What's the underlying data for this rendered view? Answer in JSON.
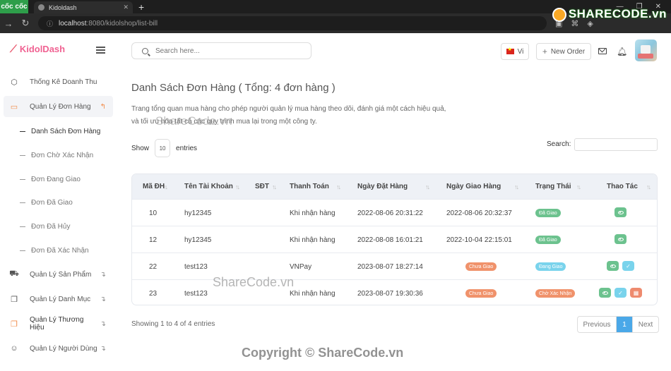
{
  "browser": {
    "brand_label": "cốc cốc",
    "tab_title": "Kidoldash",
    "url_host": "localhost",
    "url_path": ":8080/kidolshop/list-bill",
    "watermark_logo": "SHARECODE.vn"
  },
  "sidebar": {
    "logo_text": "KidolDash",
    "items": [
      {
        "label": "Thống Kê Doanh Thu",
        "icon": "cube-icon",
        "arrow": ""
      },
      {
        "label": "Quản Lý Đơn Hàng",
        "icon": "card-icon",
        "arrow": "↰"
      },
      {
        "label": "Quản Lý Sản Phẩm",
        "icon": "cart-icon",
        "arrow": "↴"
      },
      {
        "label": "Quản Lý Danh Mục",
        "icon": "copy-icon",
        "arrow": "↴"
      },
      {
        "label": "Quản Lý Thương Hiệu",
        "icon": "layers-icon",
        "arrow": "↴"
      },
      {
        "label": "Quản Lý Người Dùng",
        "icon": "users-icon",
        "arrow": "↴"
      }
    ],
    "sub_items": [
      "Danh Sách Đơn Hàng",
      "Đơn Chờ Xác Nhận",
      "Đơn Đang Giao",
      "Đơn Đã Giao",
      "Đơn Đã Hủy",
      "Đơn Đã Xác Nhận"
    ]
  },
  "header": {
    "search_placeholder": "Search here...",
    "lang_label": "Vi",
    "new_order_label": "New Order"
  },
  "main": {
    "title": "Danh Sách Đơn Hàng ( Tổng: 4 đơn hàng )",
    "desc_line1": "Trang tổng quan mua hàng cho phép người quản lý mua hàng theo dõi, đánh giá một cách hiệu quả,",
    "desc_line2": "và tối ưu hóa tất cả các quy trình mua lại trong một công ty.",
    "show_label": "Show",
    "entries_value": "10",
    "entries_label": "entries",
    "search_label": "Search:",
    "table": {
      "headers": [
        "Mã ĐH",
        "Tên Tài Khoản",
        "SĐT",
        "Thanh Toán",
        "Ngày Đặt Hàng",
        "Ngày Giao Hàng",
        "Trạng Thái",
        "Thao Tác"
      ],
      "rows": [
        {
          "id": "10",
          "account": "hy12345",
          "phone": "",
          "payment": "Khi nhận hàng",
          "order_date": "2022-08-06 20:31:22",
          "delivery": "2022-08-06 20:32:37",
          "delivery_badge": "",
          "status": "Đã Giao"
        },
        {
          "id": "12",
          "account": "hy12345",
          "phone": "",
          "payment": "Khi nhận hàng",
          "order_date": "2022-08-08 16:01:21",
          "delivery": "2022-10-04 22:15:01",
          "delivery_badge": "",
          "status": "Đã Giao"
        },
        {
          "id": "22",
          "account": "test123",
          "phone": "",
          "payment": "VNPay",
          "order_date": "2023-08-07 18:27:14",
          "delivery": "",
          "delivery_badge": "Chưa Giao",
          "status": "Đang Giao"
        },
        {
          "id": "23",
          "account": "test123",
          "phone": "",
          "payment": "Khi nhận hàng",
          "order_date": "2023-08-07 19:30:36",
          "delivery": "",
          "delivery_badge": "Chưa Giao",
          "status": "Chờ Xác Nhận"
        }
      ]
    },
    "showing_text": "Showing 1 to 4 of 4 entries",
    "pager": {
      "prev": "Previous",
      "current": "1",
      "next": "Next"
    }
  },
  "watermarks": {
    "center": "ShareCode.vn",
    "mid": "ShareCode.vn",
    "bottom": "Copyright © ShareCode.vn"
  }
}
